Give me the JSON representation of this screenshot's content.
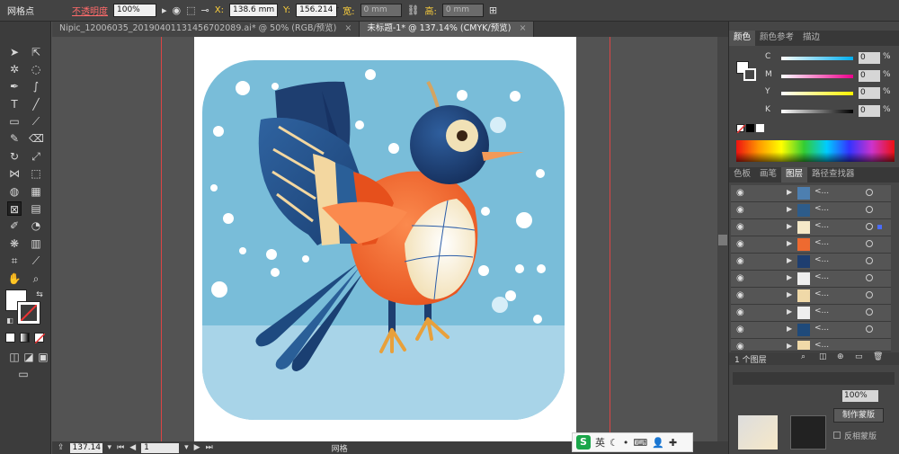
{
  "control_bar": {
    "tool_label": "网格点",
    "opacity_label": "不透明度",
    "opacity_value": "100%",
    "x_label": "X:",
    "x_value": "138.6 mm",
    "y_label": "Y:",
    "y_value": "156.214 r",
    "w_label": "宽:",
    "w_value": "0 mm",
    "h_label": "高:",
    "h_value": "0 mm"
  },
  "document_tabs": [
    {
      "label": "Nipic_12006035_20190401131456702089.ai* @ 50% (RGB/预览)",
      "close": "×"
    },
    {
      "label": "未标题-1* @ 137.14% (CMYK/预览)",
      "close": "×"
    }
  ],
  "color_panel": {
    "tabs": [
      "颜色",
      "颜色参考",
      "描边"
    ],
    "channels": [
      {
        "name": "C",
        "value": "0",
        "unit": "%"
      },
      {
        "name": "M",
        "value": "0",
        "unit": "%"
      },
      {
        "name": "Y",
        "value": "0",
        "unit": "%"
      },
      {
        "name": "K",
        "value": "0",
        "unit": "%"
      }
    ]
  },
  "layers_panel": {
    "tabs": [
      "色板",
      "画笔",
      "图层",
      "路径查找器"
    ],
    "layer_count": "1 个图层",
    "rows": [
      {
        "name": "<...",
        "thumb": "#4d7fb0"
      },
      {
        "name": "<...",
        "thumb": "#2d5c8a"
      },
      {
        "name": "<...",
        "thumb": "#f5e9c8"
      },
      {
        "name": "<...",
        "thumb": "#ee6a30"
      },
      {
        "name": "<...",
        "thumb": "#1e3e70"
      },
      {
        "name": "<...",
        "thumb": "#eeeeee"
      },
      {
        "name": "<...",
        "thumb": "#f0d9a8"
      },
      {
        "name": "<...",
        "thumb": "#eeeeee"
      },
      {
        "name": "<...",
        "thumb": "#1f4a7a"
      },
      {
        "name": "<...",
        "thumb": "#f0d9a8"
      },
      {
        "name": "<...",
        "thumb": "#ffffff"
      }
    ]
  },
  "transparency_panel": {
    "opacity_value": "100%",
    "make_mask_button": "制作蒙版",
    "invert_mask_label": "反相蒙版"
  },
  "status_bar": {
    "zoom_value": "137.14",
    "page_value": "1",
    "status_text": "网格"
  },
  "ime": {
    "logo": "S",
    "mode": "英"
  },
  "colors": {
    "sky": "#79bdd9",
    "ground": "#a8d4e8",
    "bird_orange": "#ee6a30",
    "bird_navy": "#1e3e70",
    "belly": "#f5ebcf",
    "beak": "#f39a58",
    "legs": "#e8a03b"
  }
}
